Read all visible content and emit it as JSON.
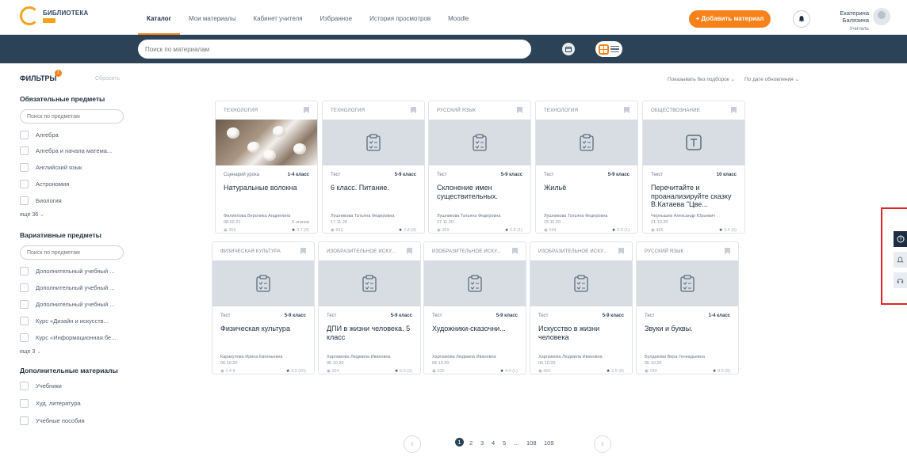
{
  "header": {
    "logo_title": "БИБЛИОТЕКА",
    "nav": [
      "Каталог",
      "Мои материалы",
      "Кабинет учителя",
      "Избранное",
      "История просмотров",
      "Moodle"
    ],
    "add_button": "+ Добавить материал",
    "user_name": "Екатерина Балязина",
    "user_role": "Учитель"
  },
  "search": {
    "placeholder": "Поиск по материалам"
  },
  "sidebar": {
    "title": "ФИЛЬТРЫ",
    "badge": "1",
    "reset": "Сбросить",
    "sections": [
      {
        "title": "Обязательные предметы",
        "placeholder": "Поиск по предметам",
        "items": [
          "Алгебра",
          "Алгебра и начала матема...",
          "Английский язык",
          "Астрономия",
          "Биология"
        ],
        "more": "еще 36"
      },
      {
        "title": "Вариативные предметы",
        "placeholder": "Поиск по предметам",
        "items": [
          "Дополнительный учебный ...",
          "Дополнительный учебный ...",
          "Дополнительный учебный ...",
          "Курс «Дизайн и искусств...",
          "Курс «Информационная бе..."
        ],
        "more": "еще 3"
      },
      {
        "title": "Дополнительные материалы",
        "items": [
          "Учебники",
          "Худ. литература",
          "Учебные пособия"
        ]
      }
    ]
  },
  "sort": {
    "filter": "Показывать без подборок",
    "order": "По дате обновления"
  },
  "cards": [
    {
      "category": "ТЕХНОЛОГИЯ",
      "type": "Сценарий урока",
      "grade": "1-4 класс",
      "title": "Натуральные волокна",
      "author": "Филиппова Вероника Андреевна",
      "date": "08.02.21",
      "stages": "6 этапов",
      "views": "369",
      "rating": "3.7 (6)",
      "thumb": "photo"
    },
    {
      "category": "ТЕХНОЛОГИЯ",
      "type": "Тест",
      "grade": "5-9 класс",
      "title": "6 класс. Питание.",
      "author": "Лушникова Татьяна Федеровна",
      "date": "17.11.20",
      "stages": "",
      "views": "843",
      "rating": "2.8 (9)",
      "thumb": "test"
    },
    {
      "category": "РУССКИЙ ЯЗЫК",
      "type": "Тест",
      "grade": "5-9 класс",
      "title": "Склонение имен существительных.",
      "author": "Лушникова Татьяна Федеровна",
      "date": "17.11.20",
      "stages": "",
      "views": "359",
      "rating": "5.0 (1)",
      "thumb": "test"
    },
    {
      "category": "ТЕХНОЛОГИЯ",
      "type": "Тест",
      "grade": "5-9 класс",
      "title": "Жильё",
      "author": "Лушникова Татьяна Федеровна",
      "date": "15.11.20",
      "stages": "",
      "views": "244",
      "rating": "2.0 (1)",
      "thumb": "test"
    },
    {
      "category": "ОБЩЕСТВОЗНАНИЕ",
      "type": "Текст",
      "grade": "10 класс",
      "title": "Перечитайте и проанализируйте сказку В.Катаева \"Цве...",
      "author": "Чернышев Александр Юрьевич",
      "date": "21.10.20",
      "stages": "",
      "views": "485",
      "rating": "3.4 (5)",
      "thumb": "text"
    },
    {
      "category": "ФИЗИЧЕСКАЯ КУЛЬТУРА",
      "type": "Тест",
      "grade": "5-9 класс",
      "title": "Физическая культура",
      "author": "Каракулова Ирина Евгеньевна",
      "date": "06.10.20",
      "stages": "",
      "views": "1.4 К",
      "rating": "3.3 (20)",
      "thumb": "test"
    },
    {
      "category": "ИЗОБРАЗИТЕЛЬНОЕ ИСКУ...",
      "type": "Тест",
      "grade": "5-9 класс",
      "title": "ДПИ в жизни человека. 5 класс",
      "author": "Харламова Людмила Ивановна",
      "date": "06.10.20",
      "stages": "",
      "views": "334",
      "rating": "5.0 (2)",
      "thumb": "test"
    },
    {
      "category": "ИЗОБРАЗИТЕЛЬНОЕ ИСКУ...",
      "type": "Тест",
      "grade": "5-9 класс",
      "title": "Художники-сказочни...",
      "author": "Харламова Людмила Ивановна",
      "date": "06.10.20",
      "stages": "",
      "views": "335",
      "rating": "4.0 (1)",
      "thumb": "test"
    },
    {
      "category": "ИЗОБРАЗИТЕЛЬНОЕ ИСКУ...",
      "type": "Тест",
      "grade": "5-9 класс",
      "title": "Искусство в жизни человека",
      "author": "Харламова Людмила Ивановна",
      "date": "05.10.20",
      "stages": "",
      "views": "665",
      "rating": "2.5 (8)",
      "thumb": "test"
    },
    {
      "category": "РУССКИЙ ЯЗЫК",
      "type": "Тест",
      "grade": "1-4 класс",
      "title": "Звуки и буквы.",
      "author": "Булдакова Вера Геннадьевна",
      "date": "05.10.20",
      "stages": "",
      "views": "784",
      "rating": "3.0 (8)",
      "thumb": "test"
    }
  ],
  "pagination": {
    "pages": [
      "1",
      "2",
      "3",
      "4",
      "5",
      "...",
      "108",
      "109"
    ],
    "active": "1"
  }
}
